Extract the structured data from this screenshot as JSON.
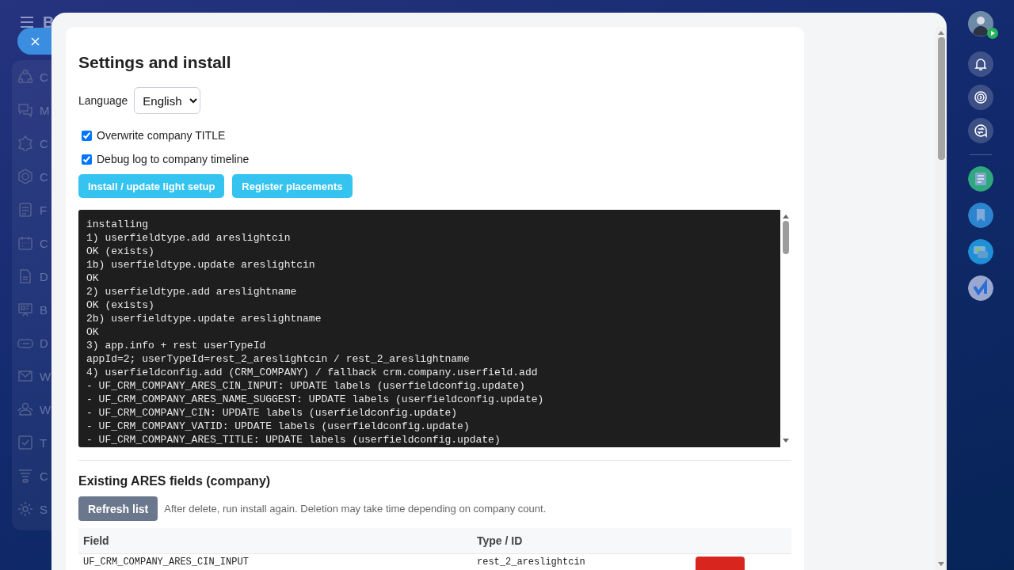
{
  "portal": {
    "brand": "B"
  },
  "sidebar": {
    "items": [
      {
        "label": "C"
      },
      {
        "label": "M"
      },
      {
        "label": "C"
      },
      {
        "label": "C"
      },
      {
        "label": "F"
      },
      {
        "label": "C"
      },
      {
        "label": "D"
      },
      {
        "label": "B"
      },
      {
        "label": "D"
      },
      {
        "label": "W"
      },
      {
        "label": "W"
      },
      {
        "label": "T"
      },
      {
        "label": "C"
      },
      {
        "label": "S"
      }
    ]
  },
  "settings": {
    "title": "Settings and install",
    "language": {
      "label": "Language",
      "value": "English"
    },
    "options": [
      {
        "label": "Overwrite company TITLE",
        "checked": true
      },
      {
        "label": "Debug log to company timeline",
        "checked": true
      }
    ],
    "buttons": [
      "Install / update light setup",
      "Register placements"
    ],
    "log": [
      "installing",
      "1) userfieldtype.add areslightcin",
      "OK (exists)",
      "1b) userfieldtype.update areslightcin",
      "OK",
      "2) userfieldtype.add areslightname",
      "OK (exists)",
      "2b) userfieldtype.update areslightname",
      "OK",
      "3) app.info + rest userTypeId",
      "appId=2; userTypeId=rest_2_areslightcin / rest_2_areslightname",
      "4) userfieldconfig.add (CRM_COMPANY) / fallback crm.company.userfield.add",
      "- UF_CRM_COMPANY_ARES_CIN_INPUT: UPDATE labels (userfieldconfig.update)",
      "- UF_CRM_COMPANY_ARES_NAME_SUGGEST: UPDATE labels (userfieldconfig.update)",
      "- UF_CRM_COMPANY_CIN: UPDATE labels (userfieldconfig.update)",
      "- UF_CRM_COMPANY_VATID: UPDATE labels (userfieldconfig.update)",
      "- UF_CRM_COMPANY_ARES_TITLE: UPDATE labels (userfieldconfig.update)"
    ],
    "fields_section": {
      "title": "Existing ARES fields (company)",
      "refresh_button": "Refresh list",
      "hint": "After delete, run install again. Deletion may take time depending on company count.",
      "columns": [
        "Field",
        "Type / ID"
      ],
      "rows": [
        {
          "field": "UF_CRM_COMPANY_ARES_CIN_INPUT",
          "type": "rest_2_areslightcin"
        }
      ]
    }
  }
}
